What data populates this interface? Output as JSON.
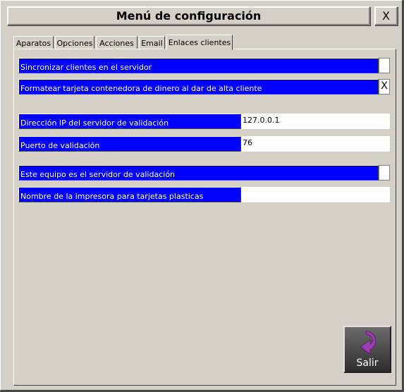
{
  "window": {
    "title": "Menú de configuración",
    "close_label": "X"
  },
  "tabs": [
    {
      "label": "Aparatos"
    },
    {
      "label": "Opciones"
    },
    {
      "label": "Acciones"
    },
    {
      "label": "Email"
    },
    {
      "label": "Enlaces clientes",
      "active": true
    }
  ],
  "settings": {
    "sync_clients": {
      "label": "Sincronizar clientes en el servidor",
      "checked": false
    },
    "format_card": {
      "label": "Formatear tarjeta contenedora de dinero al dar de alta cliente",
      "checked": true,
      "mark": "X"
    },
    "validation_ip": {
      "label": "Dirección IP del servidor de validación",
      "value": "127.0.0.1"
    },
    "validation_port": {
      "label": "Puerto de validación",
      "value": "76"
    },
    "is_validation_server": {
      "label": "Este equipo es el servidor de validación",
      "checked": false
    },
    "card_printer": {
      "label": "Nombre de la impresora para tarjetas plasticas",
      "value": ""
    }
  },
  "buttons": {
    "exit_label": "Salir"
  },
  "colors": {
    "label_bg": "#0000ff",
    "window_bg": "#d4d0c8"
  }
}
